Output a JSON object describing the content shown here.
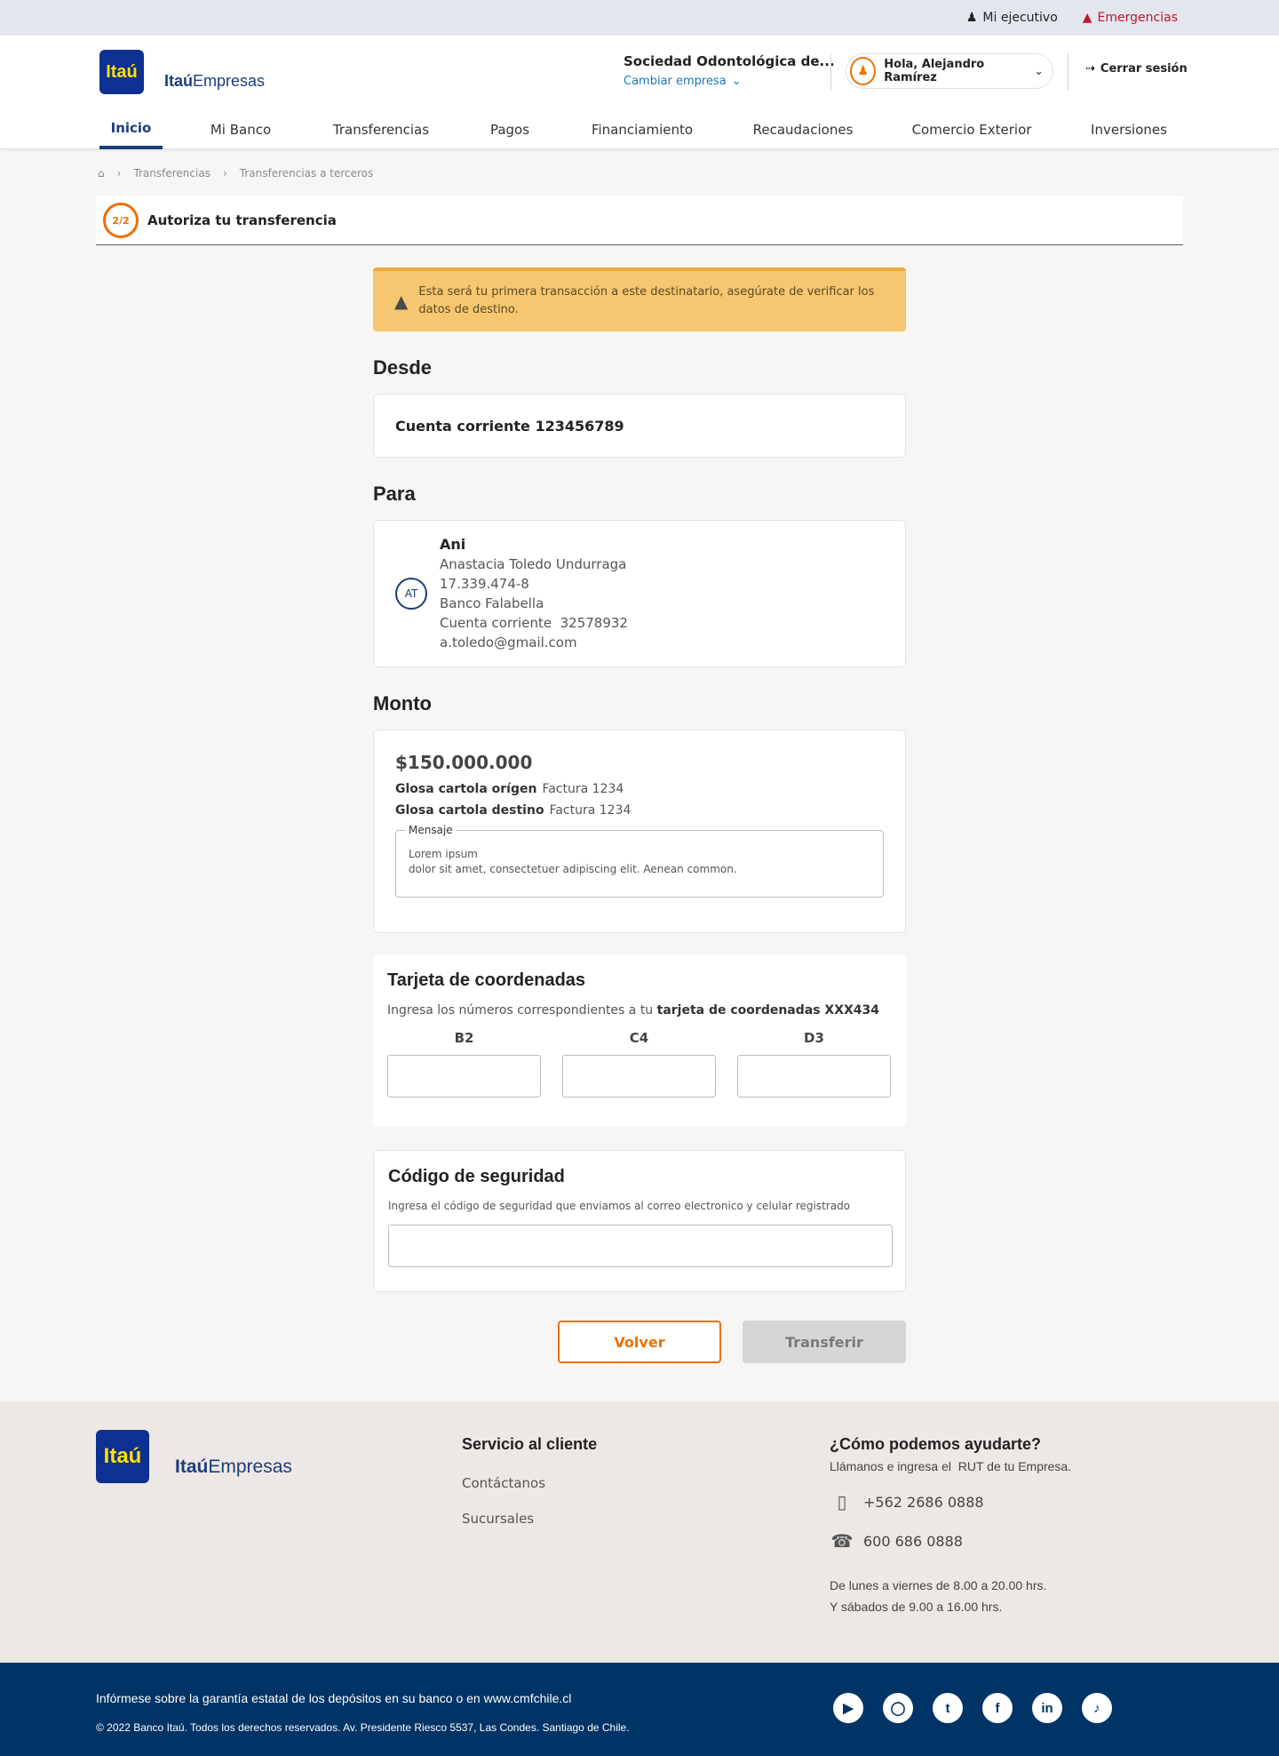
{
  "topbar": {
    "executive": "Mi ejecutivo",
    "emergencies": "Emergencias"
  },
  "header": {
    "logo_text": "Itaú",
    "brand_bold": "Itaú",
    "brand_light": "Empresas",
    "company_name": "Sociedad Odontológica de...",
    "change_company": "Cambiar empresa",
    "greeting": "Hola, Alejandro Ramírez",
    "logout": "Cerrar sesión"
  },
  "nav": {
    "tabs": [
      "Inicio",
      "Mi Banco",
      "Transferencias",
      "Pagos",
      "Financiamiento",
      "Recaudaciones",
      "Comercio Exterior",
      "Inversiones"
    ]
  },
  "breadcrumb": {
    "items": [
      "Transferencias",
      "Transferencias a terceros"
    ]
  },
  "stepper": {
    "badge": "2/2",
    "title": "Autoriza tu transferencia"
  },
  "alert": {
    "text": "Esta será tu primera transacción a este destinatario, asegúrate de verificar los datos de destino."
  },
  "from": {
    "title": "Desde",
    "account": "Cuenta corriente 123456789"
  },
  "to": {
    "title": "Para",
    "initials": "AT",
    "nickname": "Ani",
    "full_name": "Anastacia Toledo Undurraga",
    "rut": "17.339.474-8",
    "bank": "Banco Falabella",
    "account": "Cuenta corriente  32578932",
    "email": "a.toledo@gmail.com"
  },
  "amount": {
    "title": "Monto",
    "value": "$150.000.000",
    "origin_label": "Glosa cartola orígen",
    "origin_value": "Factura 1234",
    "dest_label": "Glosa cartola destino",
    "dest_value": "Factura 1234",
    "message_label": "Mensaje",
    "message_line1": "Lorem ipsum",
    "message_line2": "dolor sit amet, consectetuer adipiscing elit. Aenean common."
  },
  "coords": {
    "title": "Tarjeta de coordenadas",
    "desc_prefix": "Ingresa los números correspondientes a tu",
    "desc_bold": "tarjeta de coordenadas XXX434",
    "labels": [
      "B2",
      "C4",
      "D3"
    ]
  },
  "security": {
    "title": "Código de seguridad",
    "desc": "Ingresa el código de seguridad que enviamos al correo electronico y celular registrado"
  },
  "buttons": {
    "back": "Volver",
    "transfer": "Transferir"
  },
  "footer": {
    "service_title": "Servicio al cliente",
    "contact": "Contáctanos",
    "branches": "Sucursales",
    "help_title": "¿Cómo podemos ayudarte?",
    "help_sub": "Llámanos e ingresa el  RUT de tu Empresa.",
    "phone1": "+562 2686 0888",
    "phone2": "600 686 0888",
    "hours1": "De lunes a viernes de 8.00 a 20.00 hrs.",
    "hours2": "Y sábados de 9.00 a 16.00 hrs.",
    "guarantee": "Infórmese sobre la garantía estatal de los depósitos en su banco o en www.cmfchile.cl",
    "copyright": "© 2022 Banco Itaú. Todos los derechos reservados. Av. Presidente Riesco 5537, Las Condes. Santiago de Chile."
  },
  "socials": [
    "youtube-icon",
    "instagram-icon",
    "twitter-icon",
    "facebook-icon",
    "linkedin-icon",
    "tiktok-icon"
  ],
  "colors": {
    "brand_blue": "#0d3092",
    "accent_orange": "#ec7000",
    "alert_yellow": "#f6c670",
    "footer_navy": "#003366"
  }
}
